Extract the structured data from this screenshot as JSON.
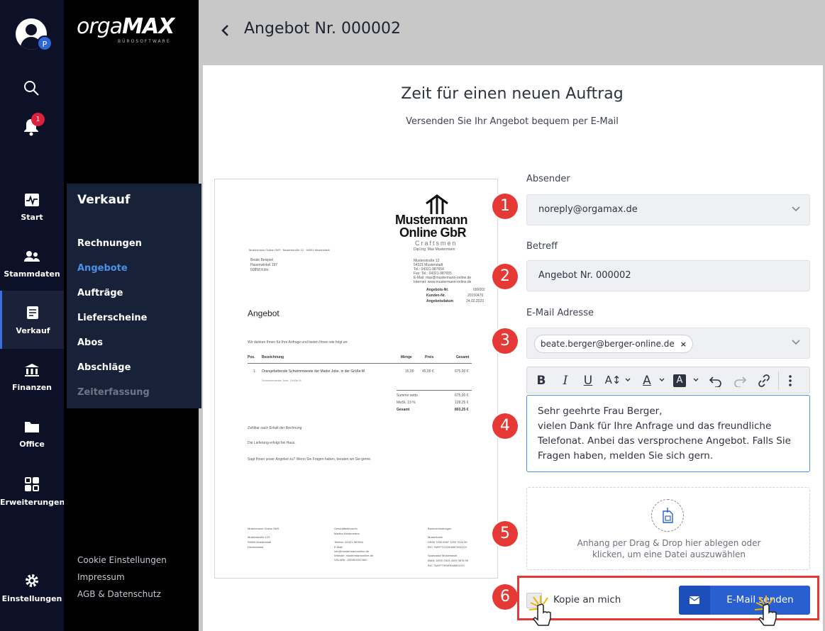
{
  "rail": {
    "avatar_badge": "P",
    "notification_count": "1",
    "items": [
      {
        "label": "Start",
        "icon": "pulse-icon"
      },
      {
        "label": "Stammdaten",
        "icon": "users-icon"
      },
      {
        "label": "Verkauf",
        "icon": "receipt-icon",
        "active": true
      },
      {
        "label": "Finanzen",
        "icon": "bank-icon"
      },
      {
        "label": "Office",
        "icon": "folder-icon"
      },
      {
        "label": "Erweiterungen",
        "icon": "grid-icon"
      },
      {
        "label": "Einstellungen",
        "icon": "gear-icon"
      }
    ]
  },
  "logo": {
    "main_light": "orga",
    "main_bold": "MAX",
    "sub": "BÜROSOFTWARE"
  },
  "sidebar": {
    "section_title": "Verkauf",
    "links": [
      "Rechnungen",
      "Angebote",
      "Aufträge",
      "Lieferscheine",
      "Abos",
      "Abschläge",
      "Zeiterfassung"
    ],
    "active_link": "Angebote",
    "footer": [
      "Cookie Einstellungen",
      "Impressum",
      "AGB & Datenschutz"
    ]
  },
  "header": {
    "title": "Angebot Nr. 000002"
  },
  "hero": {
    "title": "Zeit für einen neuen Auftrag",
    "subtitle": "Versenden Sie Ihr Angebot bequem per E-Mail"
  },
  "document": {
    "company_line1": "Mustermann",
    "company_line2": "Online GbR",
    "company_tag": "Craftsmen",
    "sender_line": "Mustermann Online GbR · Musterstraße 12 · 54321 Musterstadt",
    "owner": "Dipl.Ing. Max Mustermann",
    "address_right": [
      "Musterstraße 12",
      "54321 Musterstadt",
      "Tel.: 04321-987654",
      "Fax: Tel.: 04321-987655",
      "E-Mail: max@mustermann-online.de",
      "Internet: www.mustermann-online.de"
    ],
    "recipient": [
      "Beate Beispiel",
      "Hasenwinkel 197",
      "50858 Köln"
    ],
    "meta": [
      [
        "Angebots-Nr.",
        "000002"
      ],
      [
        "Kunden-Nr.",
        "20150476"
      ],
      [
        "Angebotsdatum",
        "24.02.2023"
      ]
    ],
    "title": "Angebot",
    "intro": "Wir danken Ihnen für Ihre Anfrage und bieten Ihnen wie folgt an:",
    "table_headers": [
      "Pos.",
      "Bezeichnung",
      "Menge",
      "Preis",
      "Gesamt"
    ],
    "row": {
      "pos": "1.",
      "desc": "Orangefarbende Schwimmweste der Marke Jobe, in der Größe M",
      "menge": "15,00",
      "preis": "45,00 €",
      "gesamt": "675,00 €",
      "sub": "Schwimmweste Jobe, Größe M"
    },
    "totals": [
      [
        "Summe netto",
        "675,00 €"
      ],
      [
        "MwSt. 19 %",
        "128,25 €"
      ],
      [
        "Gesamt",
        "803,25 €"
      ]
    ],
    "notes": [
      "Zahlbar nach Erhalt der Rechnung",
      "Die Lieferung erfolgt frei Haus.",
      "Sagt Ihnen unser Angebot zu? Wenn Sie Fragen haben, beraten wir Sie gerne."
    ],
    "footer_cols": [
      [
        "Mustermann Online GbR",
        "",
        "Musterstraße 123",
        "09654 Musterstadt",
        "Deutschland"
      ],
      [
        "Geschäftsführer/in",
        "Martha Mustermann",
        "",
        "Telefon: 04321-987654",
        "E-Mail:",
        "info@mustermannonline.de",
        "Website: mustermannonline.de",
        "USt-IdNr.: DE9810347860"
      ],
      [
        "Bankverbindungen",
        "",
        "Musterbank",
        "DE56 7000 0987 1000 7624 90",
        "BIC: SWIFTCODEABCMXXXX",
        "",
        "Sparkasse Musterstadt",
        "IBAN: DE00 2005 4009 3878 99",
        "BIC: SWIFTSPAREMMXXXX"
      ]
    ]
  },
  "form": {
    "sender_label": "Absender",
    "sender_value": "noreply@orgamax.de",
    "subject_label": "Betreff",
    "subject_value": "Angebot Nr. 000002",
    "email_label": "E-Mail Adresse",
    "email_chip": "beate.berger@berger-online.de",
    "chip_remove": "×",
    "toolbar": {
      "bold": "B",
      "italic": "I",
      "underline": "U",
      "font_size": "A↕",
      "font_color": "A",
      "highlight": "A"
    },
    "message_lines": [
      "Sehr geehrte Frau Berger,",
      "vielen Dank für Ihre Anfrage und das freundliche Telefonat. Anbei das versprochene Angebot. Falls Sie Fragen haben, melden Sie sich gern."
    ],
    "dropzone_text": "Anhang per Drag & Drop hier ablegen oder klicken, um eine Datei auszuwählen",
    "copy_label": "Kopie an mich",
    "send_label": "E-Mail senden"
  },
  "annotations": [
    "1",
    "2",
    "3",
    "4",
    "5",
    "6"
  ],
  "colors": {
    "accent": "#2a5fd0",
    "marker": "#e53935",
    "rail": "#0c1128"
  }
}
